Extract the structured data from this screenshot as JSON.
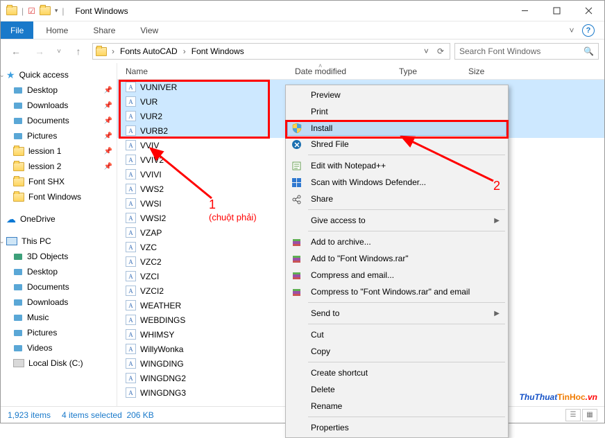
{
  "window": {
    "title": "Font Windows"
  },
  "ribbon": {
    "file": "File",
    "home": "Home",
    "share": "Share",
    "view": "View"
  },
  "address": {
    "crumbs": [
      "Fonts AutoCAD",
      "Font Windows"
    ],
    "search_placeholder": "Search Font Windows"
  },
  "nav": {
    "quick_access": "Quick access",
    "items_quick": [
      {
        "label": "Desktop",
        "pin": true
      },
      {
        "label": "Downloads",
        "pin": true
      },
      {
        "label": "Documents",
        "pin": true
      },
      {
        "label": "Pictures",
        "pin": true
      },
      {
        "label": "lession 1",
        "pin": true
      },
      {
        "label": "lession 2",
        "pin": true
      },
      {
        "label": "Font SHX",
        "pin": false
      },
      {
        "label": "Font Windows",
        "pin": false
      }
    ],
    "onedrive": "OneDrive",
    "thispc": "This PC",
    "items_pc": [
      "3D Objects",
      "Desktop",
      "Documents",
      "Downloads",
      "Music",
      "Pictures",
      "Videos",
      "Local Disk (C:)"
    ]
  },
  "columns": {
    "name": "Name",
    "date": "Date modified",
    "type": "Type",
    "size": "Size"
  },
  "files": [
    {
      "name": "VUNIVER",
      "selected": true
    },
    {
      "name": "VUR",
      "selected": true
    },
    {
      "name": "VUR2",
      "selected": true
    },
    {
      "name": "VURB2",
      "selected": true
    },
    {
      "name": "VVIV",
      "selected": false
    },
    {
      "name": "VVIV2",
      "selected": false
    },
    {
      "name": "VVIVI",
      "selected": false
    },
    {
      "name": "VWS2",
      "selected": false
    },
    {
      "name": "VWSI",
      "selected": false
    },
    {
      "name": "VWSI2",
      "selected": false
    },
    {
      "name": "VZAP",
      "selected": false
    },
    {
      "name": "VZC",
      "selected": false
    },
    {
      "name": "VZC2",
      "selected": false
    },
    {
      "name": "VZCI",
      "selected": false
    },
    {
      "name": "VZCI2",
      "selected": false
    },
    {
      "name": "WEATHER",
      "selected": false
    },
    {
      "name": "WEBDINGS",
      "selected": false
    },
    {
      "name": "WHIMSY",
      "selected": false
    },
    {
      "name": "WillyWonka",
      "selected": false
    },
    {
      "name": "WINGDING",
      "selected": false
    },
    {
      "name": "WINGDNG2",
      "selected": false
    },
    {
      "name": "WINGDNG3",
      "selected": false
    }
  ],
  "context_menu": {
    "preview": "Preview",
    "print": "Print",
    "install": "Install",
    "shred": "Shred File",
    "notepad": "Edit with Notepad++",
    "defender": "Scan with Windows Defender...",
    "share": "Share",
    "give_access": "Give access to",
    "add_archive": "Add to archive...",
    "add_rar": "Add to \"Font Windows.rar\"",
    "compress_email": "Compress and email...",
    "compress_rar_email": "Compress to \"Font Windows.rar\" and email",
    "send_to": "Send to",
    "cut": "Cut",
    "copy": "Copy",
    "shortcut": "Create shortcut",
    "delete": "Delete",
    "rename": "Rename",
    "properties": "Properties"
  },
  "annotations": {
    "num1": "1",
    "note1": "(chuột phải)",
    "num2": "2"
  },
  "status": {
    "items": "1,923 items",
    "selected": "4 items selected",
    "size": "206 KB"
  },
  "watermark": {
    "t1": "ThuThuat",
    "t2": "TinHoc",
    "t3": ".vn"
  }
}
